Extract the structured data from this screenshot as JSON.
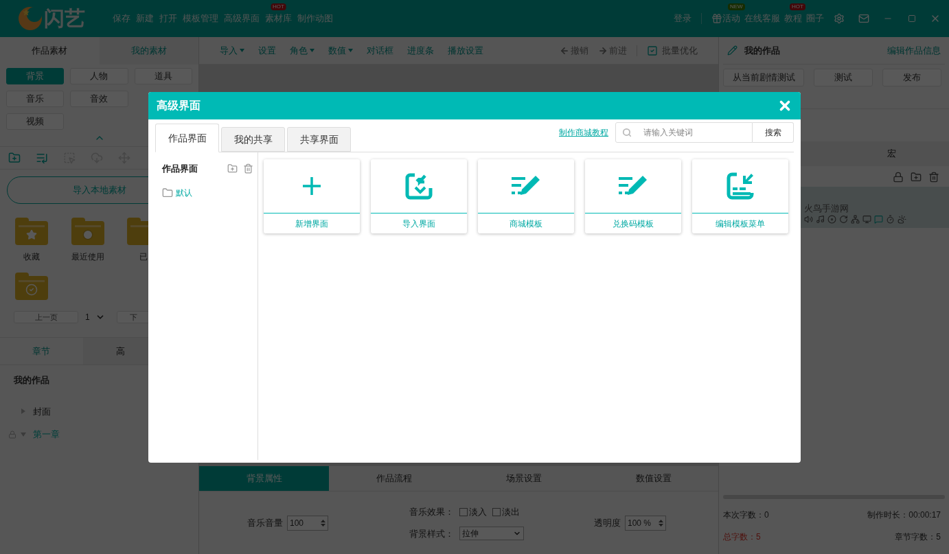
{
  "app_bar": {
    "logo": "闪艺",
    "menu": [
      {
        "label": "保存"
      },
      {
        "label": "新建"
      },
      {
        "label": "打开"
      },
      {
        "label": "模板管理"
      },
      {
        "label": "高级界面"
      },
      {
        "label": "素材库",
        "badge": "HOT"
      },
      {
        "label": "制作动图"
      }
    ],
    "login": "登录",
    "links": [
      {
        "label": "活动",
        "badge": "NEW",
        "kind": "gift"
      },
      {
        "label": "在线客服"
      },
      {
        "label": "教程",
        "badge": "HOT"
      },
      {
        "label": "圈子"
      }
    ]
  },
  "left_panel": {
    "tabs": [
      {
        "label": "作品素材",
        "selected": true
      },
      {
        "label": "我的素材",
        "selected": false
      }
    ],
    "category_rows": [
      [
        {
          "label": "背景",
          "selected": true
        },
        {
          "label": "人物",
          "selected": false
        },
        {
          "label": "道具",
          "selected": false
        }
      ],
      [
        {
          "label": "音乐",
          "selected": false
        },
        {
          "label": "音效",
          "selected": false
        }
      ],
      [
        {
          "label": "视频",
          "selected": false
        }
      ]
    ],
    "import_button": "导入本地素材",
    "folders": [
      {
        "label": "收藏",
        "kind": "star"
      },
      {
        "label": "最近使用",
        "kind": "clock"
      },
      {
        "label": "已",
        "kind": "plain"
      },
      {
        "kind": "check"
      }
    ],
    "pagination": {
      "prev": "上一页",
      "page": "1",
      "next": "下"
    },
    "bottom_tabs": [
      {
        "label": "章节",
        "selected": true
      },
      {
        "label": "高",
        "selected": false
      }
    ],
    "work_title": "我的作品",
    "tree": [
      {
        "label": "封面",
        "expanded": false,
        "locked": false,
        "selected": false
      },
      {
        "label": "第一章",
        "expanded": true,
        "locked": true,
        "selected": true
      }
    ]
  },
  "toolbar": {
    "items": [
      {
        "label": "导入",
        "dropdown": true
      },
      {
        "label": "设置",
        "dropdown": false
      },
      {
        "label": "角色",
        "dropdown": true
      },
      {
        "label": "数值",
        "dropdown": true
      },
      {
        "label": "对话框",
        "dropdown": false
      },
      {
        "label": "进度条",
        "dropdown": false
      },
      {
        "label": "播放设置",
        "dropdown": false
      }
    ],
    "undo": {
      "label": "撤销",
      "disabled": true
    },
    "redo": {
      "label": "前进",
      "disabled": true
    },
    "batch": "批量优化"
  },
  "properties": {
    "tabs": [
      {
        "label": "背景属性",
        "selected": true
      },
      {
        "label": "作品流程",
        "selected": false
      },
      {
        "label": "场景设置",
        "selected": false
      },
      {
        "label": "数值设置",
        "selected": false
      }
    ],
    "volume_label": "音乐音量",
    "volume": "100",
    "effect_label": "音乐效果：",
    "effects": [
      {
        "label": "淡入",
        "checked": false
      },
      {
        "label": "淡出",
        "checked": false
      }
    ],
    "style_label": "背景样式：",
    "style": "拉伸",
    "opacity_label": "透明度",
    "opacity": "100 %"
  },
  "right_panel": {
    "title": "我的作品",
    "edit_link": "编辑作品信息",
    "buttons": [
      "从当前剧情测试",
      "测试",
      "发布"
    ],
    "tab": "宏",
    "item_text": "火鸟手游网",
    "stats": [
      {
        "label": "本次字数：0",
        "alert": false
      },
      {
        "label": "制作时长：00:00:17",
        "alert": false
      },
      {
        "label": "总字数：5",
        "alert": true
      },
      {
        "label": "章节字数：5",
        "alert": false
      }
    ]
  },
  "dialog": {
    "title": "高级界面",
    "tabs": [
      {
        "label": "作品界面",
        "selected": true
      },
      {
        "label": "我的共享",
        "selected": false
      },
      {
        "label": "共享界面",
        "selected": false
      }
    ],
    "tutorial_link": "制作商城教程",
    "search": {
      "placeholder": "请输入关键词",
      "button": "搜索"
    },
    "sidebar": {
      "title": "作品界面",
      "folders": [
        {
          "label": "默认"
        }
      ]
    },
    "cards": [
      {
        "label": "新增界面",
        "kind": "plus"
      },
      {
        "label": "导入界面",
        "kind": "import"
      },
      {
        "label": "商城模板",
        "kind": "list-edit"
      },
      {
        "label": "兑换码模板",
        "kind": "list-edit"
      },
      {
        "label": "编辑模板菜单",
        "kind": "menu-edit"
      }
    ]
  }
}
